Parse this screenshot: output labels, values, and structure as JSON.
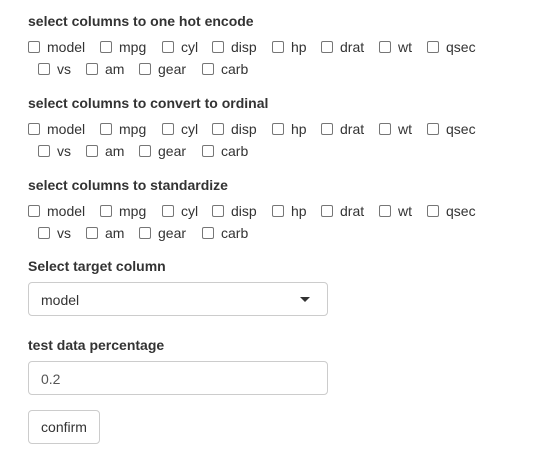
{
  "groups": [
    {
      "label": "select columns to one hot encode",
      "options": [
        "model",
        "mpg",
        "cyl",
        "disp",
        "hp",
        "drat",
        "wt",
        "qsec",
        "vs",
        "am",
        "gear",
        "carb"
      ]
    },
    {
      "label": "select columns to convert to ordinal",
      "options": [
        "model",
        "mpg",
        "cyl",
        "disp",
        "hp",
        "drat",
        "wt",
        "qsec",
        "vs",
        "am",
        "gear",
        "carb"
      ]
    },
    {
      "label": "select columns to standardize",
      "options": [
        "model",
        "mpg",
        "cyl",
        "disp",
        "hp",
        "drat",
        "wt",
        "qsec",
        "vs",
        "am",
        "gear",
        "carb"
      ]
    }
  ],
  "target": {
    "label": "Select target column",
    "value": "model"
  },
  "test_pct": {
    "label": "test data percentage",
    "value": "0.2"
  },
  "confirm_label": "confirm"
}
